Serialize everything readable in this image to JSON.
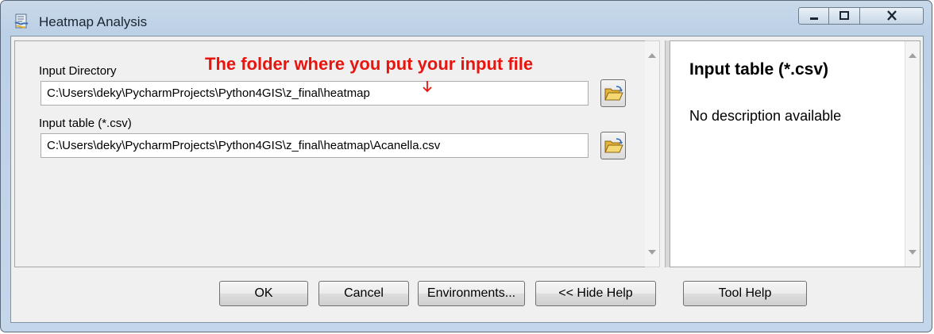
{
  "window": {
    "title": "Heatmap Analysis",
    "icon": "python-script-icon"
  },
  "params": [
    {
      "label": "Input Directory",
      "value": "C:\\Users\\deky\\PycharmProjects\\Python4GIS\\z_final\\heatmap",
      "browse_icon": "folder-open-icon"
    },
    {
      "label": "Input table (*.csv)",
      "value": "C:\\Users\\deky\\PycharmProjects\\Python4GIS\\z_final\\heatmap\\Acanella.csv",
      "browse_icon": "folder-open-icon"
    }
  ],
  "annotation": {
    "text": "The folder where you put your input file",
    "color": "#e8150f"
  },
  "help": {
    "title": "Input table (*.csv)",
    "description": "No description available"
  },
  "buttons": {
    "ok": "OK",
    "cancel": "Cancel",
    "environments": "Environments...",
    "hide_help": "<< Hide Help",
    "tool_help": "Tool Help"
  }
}
